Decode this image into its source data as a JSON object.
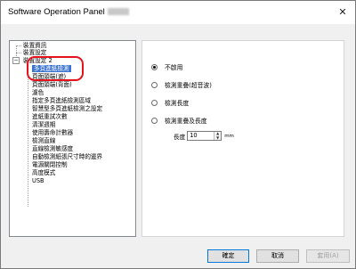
{
  "window": {
    "title": "Software Operation Panel"
  },
  "tree": {
    "items": [
      {
        "label": "裝置資訊"
      },
      {
        "label": "裝置設定"
      },
      {
        "label": "裝置設定 2"
      },
      {
        "label": "多頁進紙檢測"
      },
      {
        "label": "頁面頭端(遮)"
      },
      {
        "label": "頁面頭端(背面)"
      },
      {
        "label": "濾色"
      },
      {
        "label": "指定多頁進紙檢測區域"
      },
      {
        "label": "智慧型多頁進紙檢測之設定"
      },
      {
        "label": "進紙重試次數"
      },
      {
        "label": "清潔週期"
      },
      {
        "label": "使用壽命計數器"
      },
      {
        "label": "檢測直線"
      },
      {
        "label": "直線檢測敏感度"
      },
      {
        "label": "自動檢測紙張尺寸時的邊界"
      },
      {
        "label": "電源關閉控制"
      },
      {
        "label": "高度模式"
      },
      {
        "label": "USB"
      }
    ],
    "selected_index": 3
  },
  "options": {
    "radios": [
      {
        "label": "不啟用",
        "checked": true
      },
      {
        "label": "檢測重疊(超音波)",
        "checked": false
      },
      {
        "label": "檢測長度",
        "checked": false
      },
      {
        "label": "檢測重疊及長度",
        "checked": false
      }
    ],
    "length": {
      "label": "長度",
      "value": "10",
      "unit": "mm"
    }
  },
  "buttons": {
    "ok": "確定",
    "cancel": "取消",
    "apply": "套用(A)"
  }
}
